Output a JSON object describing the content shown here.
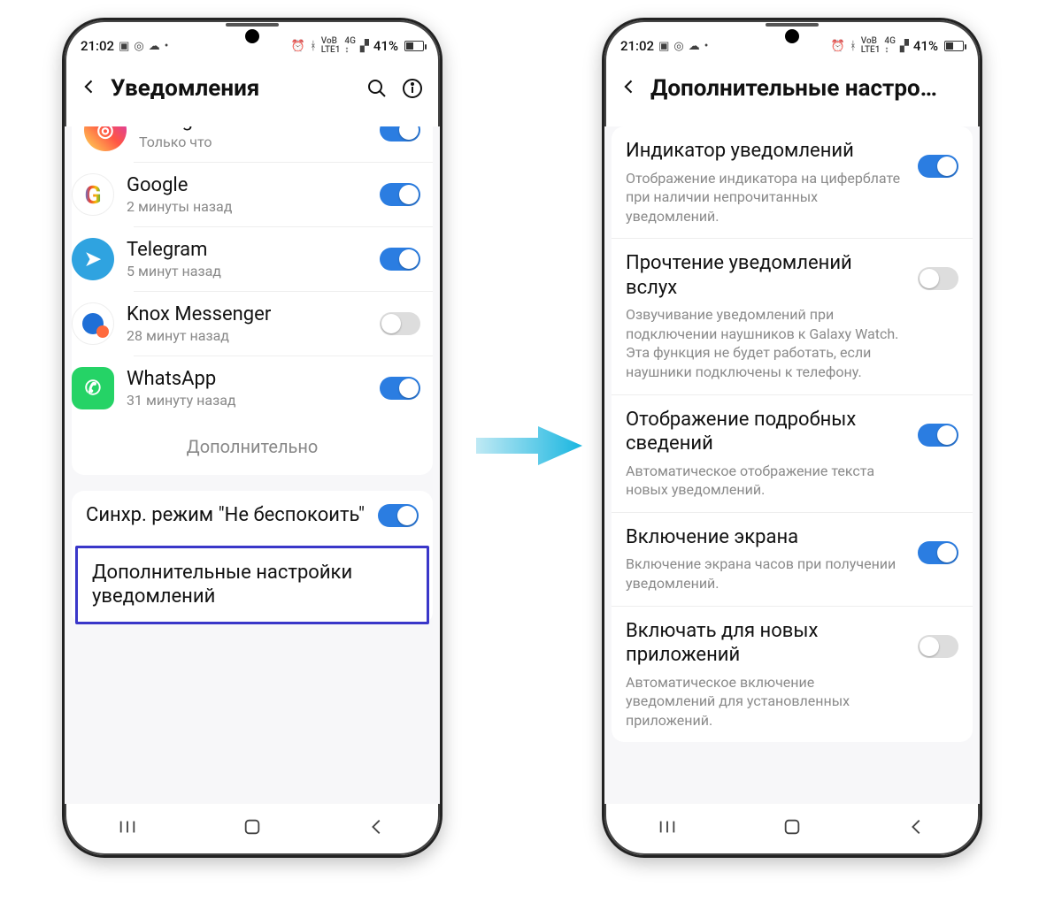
{
  "statusbar": {
    "time": "21:02",
    "battery_text": "41%"
  },
  "phone1": {
    "title": "Уведомления",
    "apps": [
      {
        "name": "Instagram",
        "sub": "Только что",
        "on": true,
        "icon": "instagram"
      },
      {
        "name": "Google",
        "sub": "2 минуты назад",
        "on": true,
        "icon": "google"
      },
      {
        "name": "Telegram",
        "sub": "5 минут назад",
        "on": true,
        "icon": "telegram"
      },
      {
        "name": "Knox Messenger",
        "sub": "28 минут назад",
        "on": false,
        "icon": "knox"
      },
      {
        "name": "WhatsApp",
        "sub": "31 минуту назад",
        "on": true,
        "icon": "whatsapp"
      }
    ],
    "more_label": "Дополнительно",
    "dnd_label": "Синхр. режим \"Не беспокоить\"",
    "dnd_on": true,
    "adv_label": "Дополнительные настройки уведомлений"
  },
  "phone2": {
    "title": "Дополнительные настро…",
    "items": [
      {
        "title": "Индикатор уведомлений",
        "desc": "Отображение индикатора на циферблате при наличии непрочитанных уведомлений.",
        "on": true
      },
      {
        "title": "Прочтение уведомлений вслух",
        "desc": "Озвучивание уведомлений при подключении наушников к Galaxy Watch. Эта функция не будет работать, если наушники подключены к телефону.",
        "on": false
      },
      {
        "title": "Отображение подробных сведений",
        "desc": "Автоматическое отображение текста новых уведомлений.",
        "on": true
      },
      {
        "title": "Включение экрана",
        "desc": "Включение экрана часов при получении уведомлений.",
        "on": true
      },
      {
        "title": "Включать для новых приложений",
        "desc": "Автоматическое включение уведомлений для установленных приложений.",
        "on": false
      }
    ]
  }
}
